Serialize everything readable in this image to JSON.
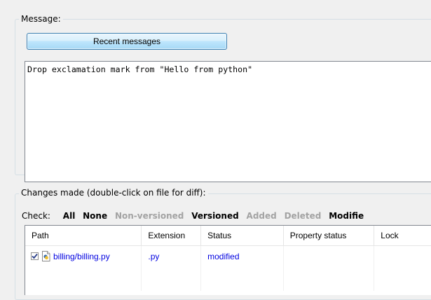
{
  "message_section": {
    "title": "Message:",
    "recent_button": "Recent messages",
    "text": "Drop exclamation mark from \"Hello from python\""
  },
  "changes_section": {
    "title": "Changes made (double-click on file for diff):",
    "check_label": "Check:",
    "filters": {
      "all": "All",
      "none": "None",
      "non_versioned": "Non-versioned",
      "versioned": "Versioned",
      "added": "Added",
      "deleted": "Deleted",
      "modified": "Modifie"
    },
    "columns": [
      "Path",
      "Extension",
      "Status",
      "Property status",
      "Lock"
    ],
    "rows": [
      {
        "checked": true,
        "path": "billing/billing.py",
        "extension": ".py",
        "status": "modified",
        "property_status": "",
        "lock": ""
      }
    ]
  },
  "colors": {
    "link_blue": "#0000e0",
    "disabled_gray": "#a3a3a3",
    "button_border": "#3c7fb1"
  }
}
